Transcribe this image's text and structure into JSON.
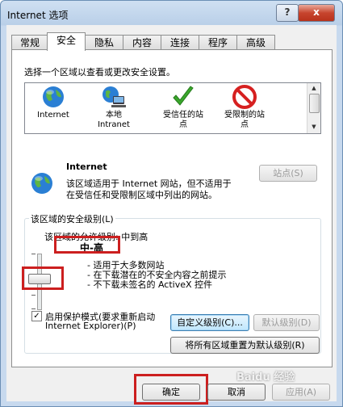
{
  "window": {
    "title": "Internet 选项",
    "help_label": "?",
    "close_label": "x"
  },
  "tabs": [
    {
      "label": "常规"
    },
    {
      "label": "安全"
    },
    {
      "label": "隐私"
    },
    {
      "label": "内容"
    },
    {
      "label": "连接"
    },
    {
      "label": "程序"
    },
    {
      "label": "高级"
    }
  ],
  "active_tab": "安全",
  "zones_prompt": "选择一个区域以查看或更改安全设置。",
  "zones": [
    {
      "name": "Internet",
      "icon": "globe-icon"
    },
    {
      "name": "本地\nIntranet",
      "icon": "intranet-icon"
    },
    {
      "name": "受信任的站\n点",
      "icon": "checkmark-icon"
    },
    {
      "name": "受限制的站\n点",
      "icon": "restricted-icon"
    }
  ],
  "zone_detail": {
    "title": "Internet",
    "description_line1": "该区域适用于 Internet 网站，但不适用于",
    "description_line2": "在受信任和受限制区域中列出的网站。",
    "sites_button": "站点(S)"
  },
  "security_level": {
    "legend": "该区域的安全级别(L)",
    "allowed_levels": "该区域的允许级别: 中到高",
    "level_name": "中-高",
    "level_position": 0.5,
    "bullets": [
      "- 适用于大多数网站",
      "- 在下载潜在的不安全内容之前提示",
      "- 不下载未签名的 ActiveX 控件"
    ],
    "protected_mode_label_line1": "启用保护模式(要求重新启动",
    "protected_mode_label_line2": "Internet Explorer)(P)",
    "protected_mode_checked": true,
    "custom_level_button": "自定义级别(C)...",
    "default_level_button": "默认级别(D)",
    "reset_all_button": "将所有区域重置为默认级别(R)"
  },
  "footer": {
    "ok_button": "确定",
    "cancel_button": "取消",
    "apply_button": "应用(A)"
  },
  "watermark": "Baidu 经验",
  "colors": {
    "highlight": "#cc1f1f",
    "title_bar": "#b9cfe8",
    "focus_border": "#3c7fb1"
  }
}
